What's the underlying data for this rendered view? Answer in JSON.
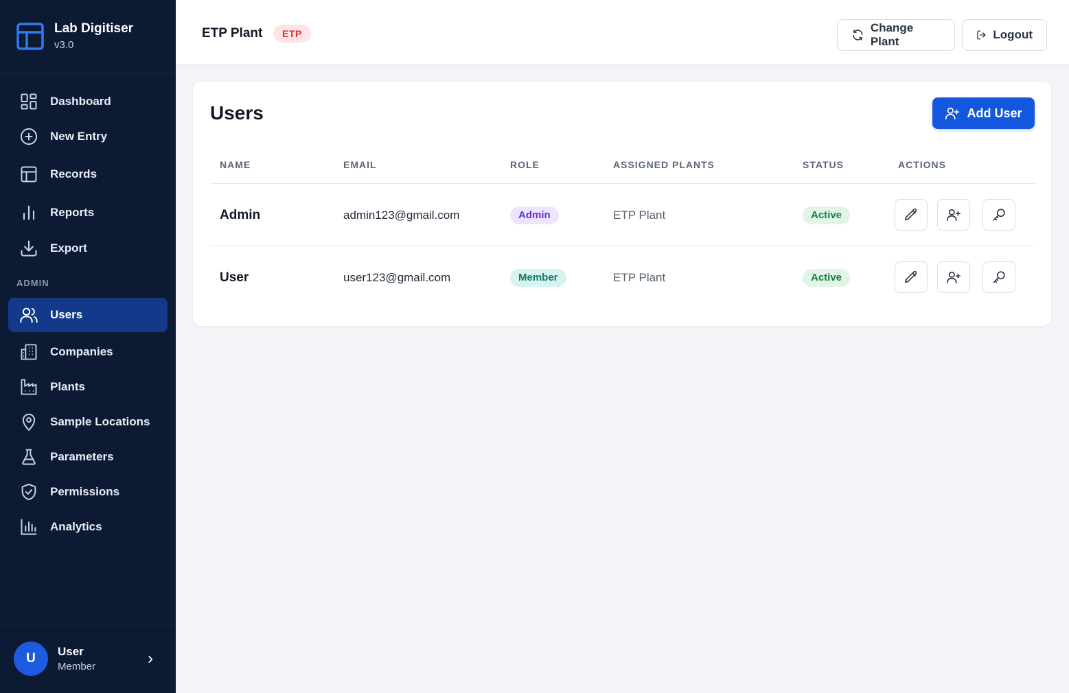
{
  "app": {
    "title": "Lab Digitiser",
    "version": "v3.0",
    "accent_color": "#1257de",
    "sidebar_color": "#0c1a33"
  },
  "sidebar": {
    "items": [
      {
        "label": "Dashboard",
        "icon": "dashboard-grid-icon"
      },
      {
        "label": "New Entry",
        "icon": "plus-circle-icon"
      },
      {
        "label": "Records",
        "icon": "table-icon"
      },
      {
        "label": "Reports",
        "icon": "bar-chart-icon"
      },
      {
        "label": "Export",
        "icon": "download-icon"
      }
    ],
    "admin_section_label": "ADMIN",
    "admin_items": [
      {
        "label": "Users",
        "icon": "users-icon",
        "active": true
      },
      {
        "label": "Companies",
        "icon": "building-icon"
      },
      {
        "label": "Plants",
        "icon": "factory-icon"
      },
      {
        "label": "Sample Locations",
        "icon": "map-pin-icon"
      },
      {
        "label": "Parameters",
        "icon": "flask-icon"
      },
      {
        "label": "Permissions",
        "icon": "shield-check-icon"
      },
      {
        "label": "Analytics",
        "icon": "analytics-chart-icon"
      }
    ],
    "current_user": {
      "initial": "U",
      "name": "User",
      "role": "Member"
    }
  },
  "header": {
    "plant_name": "ETP Plant",
    "plant_code": "ETP",
    "change_plant_label": "Change Plant",
    "logout_label": "Logout"
  },
  "users_page": {
    "title": "Users",
    "add_user_label": "Add User",
    "columns": [
      "NAME",
      "EMAIL",
      "ROLE",
      "ASSIGNED PLANTS",
      "STATUS",
      "ACTIONS"
    ],
    "rows": [
      {
        "name": "Admin",
        "email": "admin123@gmail.com",
        "role": "Admin",
        "role_type": "admin",
        "plants": "ETP Plant",
        "status": "Active"
      },
      {
        "name": "User",
        "email": "user123@gmail.com",
        "role": "Member",
        "role_type": "member",
        "plants": "ETP Plant",
        "status": "Active"
      }
    ]
  }
}
